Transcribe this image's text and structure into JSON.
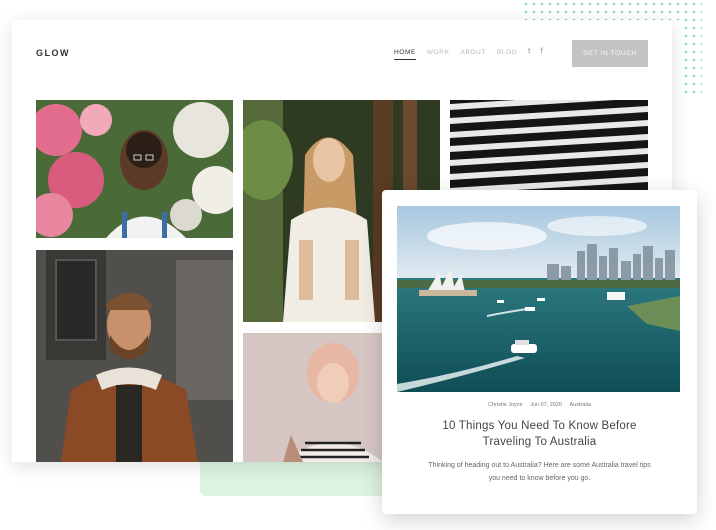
{
  "site": {
    "logo": "GLOW",
    "nav": [
      {
        "label": "HOME",
        "active": true
      },
      {
        "label": "WORK",
        "active": false
      },
      {
        "label": "ABOUT",
        "active": false
      },
      {
        "label": "BLOG",
        "active": false
      }
    ],
    "social_icons": [
      "twitter-icon",
      "facebook-icon"
    ],
    "social_glyphs": {
      "twitter": "t",
      "facebook": "f"
    },
    "cta_label": "GET IN TOUCH"
  },
  "gallery": [
    {
      "subject": "woman-flowers-photo"
    },
    {
      "subject": "woman-forest-photo"
    },
    {
      "subject": "building-photo"
    },
    {
      "subject": "man-jacket-photo"
    },
    {
      "subject": "woman-pink-hair-photo"
    }
  ],
  "card": {
    "image": "sydney-harbour-photo",
    "author": "Christie Joyce",
    "date": "Jun 07, 2020",
    "category": "Australia",
    "title": "10 Things You Need To Know Before Traveling To Australia",
    "excerpt": "Thinking of heading out to Australia? Here are some Australia travel tips you need to know before you go."
  },
  "colors": {
    "accent_dots": "#7fd69a",
    "cta_bg": "#c3c3c3",
    "green_block": "#dcf3e1"
  }
}
